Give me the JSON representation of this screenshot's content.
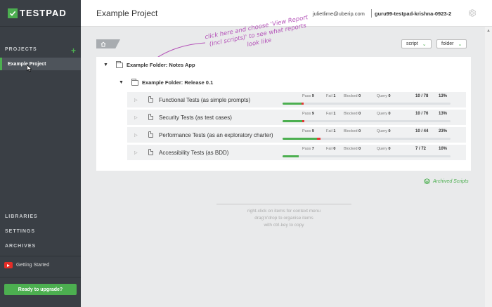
{
  "app": {
    "logo_text": "TESTPAD"
  },
  "sidebar": {
    "projects_label": "PROJECTS",
    "add_icon": "+",
    "active_project": "Example Project",
    "libraries_label": "LIBRARIES",
    "settings_label": "SETTINGS",
    "archives_label": "ARCHIVES",
    "getting_started": "Getting Started",
    "upgrade_label": "Ready to upgrade?"
  },
  "header": {
    "title": "Example Project",
    "email": "julietlime@uberip.com",
    "account": "guru99-testpad-krishna-0923-2"
  },
  "toolbar": {
    "script_label": "script",
    "folder_label": "folder"
  },
  "annotation": "click here and choose 'View Report (incl scripts)' to see what reports look like",
  "folders": {
    "top": "Example Folder: Notes App",
    "sub": "Example Folder: Release 0.1"
  },
  "stat_labels": {
    "pass": "Pass",
    "fail": "Fail",
    "blocked": "Blocked",
    "query": "Query"
  },
  "scripts": [
    {
      "name": "Functional Tests (as simple prompts)",
      "pass": "9",
      "fail": "1",
      "blocked": "0",
      "query": "0",
      "ratio": "10 / 78",
      "pct": "13%",
      "pass_frac": 0.115,
      "fail_frac": 0.013
    },
    {
      "name": "Security Tests (as test cases)",
      "pass": "9",
      "fail": "1",
      "blocked": "0",
      "query": "0",
      "ratio": "10 / 76",
      "pct": "13%",
      "pass_frac": 0.118,
      "fail_frac": 0.013
    },
    {
      "name": "Performance Tests (as an exploratory charter)",
      "pass": "9",
      "fail": "1",
      "blocked": "0",
      "query": "0",
      "ratio": "10 / 44",
      "pct": "23%",
      "pass_frac": 0.205,
      "fail_frac": 0.023
    },
    {
      "name": "Accessibility Tests (as BDD)",
      "pass": "7",
      "fail": "0",
      "blocked": "0",
      "query": "0",
      "ratio": "7 / 72",
      "pct": "10%",
      "pass_frac": 0.097,
      "fail_frac": 0
    }
  ],
  "archived_label": "Archived Scripts",
  "hint": {
    "line1": "right-click on items for context menu",
    "line2": "drag'n'drop to organise items",
    "line3": "with ctrl-key to copy"
  },
  "colors": {
    "brand_green": "#4caf50",
    "fail_red": "#e53935",
    "sidebar_bg": "#3a3f45",
    "annotation": "#b452b8"
  }
}
